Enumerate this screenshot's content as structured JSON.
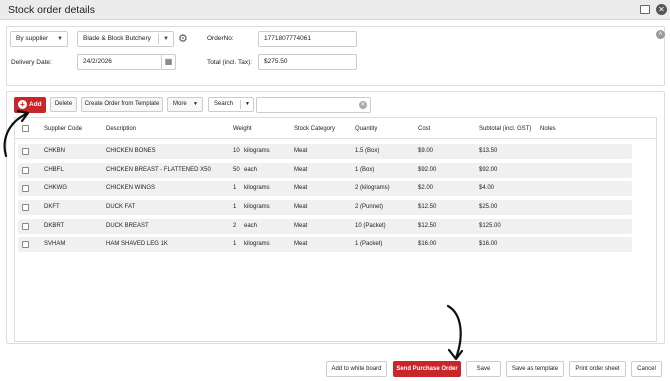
{
  "window": {
    "title": "Stock order details"
  },
  "form": {
    "supplier_mode": "By supplier",
    "supplier_name": "Blade & Block Butchery",
    "order_no_label": "OrderNo:",
    "order_no_value": "1771807774061",
    "delivery_date_label": "Delivery Date:",
    "delivery_date_value": "24/2/2026",
    "total_label": "Total (incl. Tax):",
    "total_value": "$275.50"
  },
  "toolbar": {
    "add_label": "Add",
    "delete_label": "Delete",
    "create_from_template_label": "Create Order from Template",
    "more_label": "More",
    "search_label": "Search",
    "search_value": ""
  },
  "table": {
    "columns": [
      "Supplier Code",
      "Description",
      "Weight",
      "Stock Category",
      "Quantity",
      "Cost",
      "Subtotal (incl. GST)",
      "Notes"
    ],
    "rows": [
      {
        "code": "CHKBN",
        "description": "CHICKEN BONES",
        "weight": "10",
        "unit": "kilograms",
        "category": "Meat",
        "quantity": "1.5 (Box)",
        "cost": "$9.00",
        "subtotal": "$13.50",
        "notes": ""
      },
      {
        "code": "CHBFL",
        "description": "CHICKEN BREAST - FLATTENED X50",
        "weight": "50",
        "unit": "each",
        "category": "Meat",
        "quantity": "1 (Box)",
        "cost": "$92.00",
        "subtotal": "$92.00",
        "notes": ""
      },
      {
        "code": "CHKWG",
        "description": "CHICKEN WINGS",
        "weight": "1",
        "unit": "kilograms",
        "category": "Meat",
        "quantity": "2 (kilograms)",
        "cost": "$2.00",
        "subtotal": "$4.00",
        "notes": ""
      },
      {
        "code": "DKFT",
        "description": "DUCK FAT",
        "weight": "1",
        "unit": "kilograms",
        "category": "Meat",
        "quantity": "2 (Punnet)",
        "cost": "$12.50",
        "subtotal": "$25.00",
        "notes": ""
      },
      {
        "code": "DKBRT",
        "description": "DUCK BREAST",
        "weight": "2",
        "unit": "each",
        "category": "Meat",
        "quantity": "10 (Packet)",
        "cost": "$12.50",
        "subtotal": "$125.00",
        "notes": ""
      },
      {
        "code": "SVHAM",
        "description": "HAM SHAVED LEG 1K",
        "weight": "1",
        "unit": "kilograms",
        "category": "Meat",
        "quantity": "1 (Packet)",
        "cost": "$16.00",
        "subtotal": "$16.00",
        "notes": ""
      }
    ]
  },
  "footer": {
    "add_to_whiteboard": "Add to white board",
    "send_po": "Send Purchase Order",
    "save": "Save",
    "save_as_template": "Save as template",
    "print_order_sheet": "Print order sheet",
    "cancel": "Cancel"
  },
  "icons": {
    "restore": "window-restore-icon",
    "close": "close-icon",
    "settings": "gear-icon",
    "calendar": "calendar-icon",
    "add": "plus-circle-icon",
    "clear": "clear-icon",
    "collapse": "chevron-up-icon"
  },
  "colors": {
    "accent": "#c9262c",
    "row_bg": "#f0f0f0",
    "titlebar_bg": "#ececec"
  }
}
